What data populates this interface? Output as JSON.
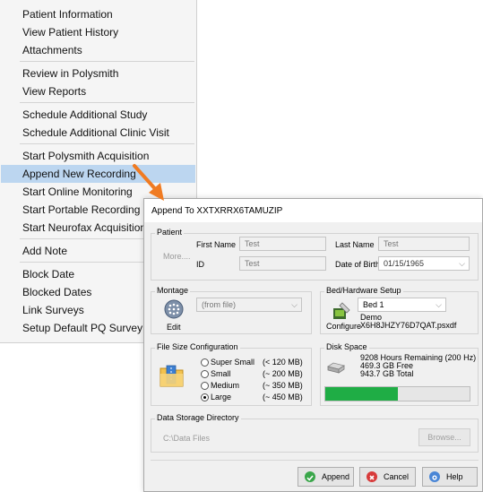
{
  "context_menu": {
    "groups": [
      [
        "Patient Information",
        "View Patient History",
        "Attachments"
      ],
      [
        "Review in Polysmith",
        "View Reports"
      ],
      [
        "Schedule Additional Study",
        "Schedule Additional Clinic Visit"
      ],
      [
        "Start Polysmith Acquisition",
        "Append New Recording",
        "Start Online Monitoring",
        "Start Portable Recording",
        "Start Neurofax Acquisition"
      ],
      [
        "Add Note"
      ],
      [
        "Block Date",
        "Blocked Dates",
        "Link Surveys",
        "Setup Default PQ Survey"
      ]
    ],
    "highlighted_item": "Append New Recording"
  },
  "dialog": {
    "title": "Append To XXTXRRX6TAMUZIP",
    "patient": {
      "group_label": "Patient",
      "first_name_label": "First Name",
      "first_name_value": "Test",
      "last_name_label": "Last Name",
      "last_name_value": "Test",
      "more_link": "More....",
      "id_label": "ID",
      "id_value": "Test",
      "dob_label": "Date of Birth",
      "dob_value": "01/15/1965"
    },
    "montage": {
      "group_label": "Montage",
      "select_value": "(from file)",
      "edit_label": "Edit"
    },
    "bed": {
      "group_label": "Bed/Hardware Setup",
      "select_value": "Bed 1",
      "info_line1": "Demo",
      "info_line2": "X6H8JHZY76D7QAT.psxdf",
      "configure_label": "Configure"
    },
    "file_size": {
      "group_label": "File Size Configuration",
      "options": [
        {
          "label": "Super Small",
          "size": "(< 120 MB)",
          "selected": false
        },
        {
          "label": "Small",
          "size": "(~ 200 MB)",
          "selected": false
        },
        {
          "label": "Medium",
          "size": "(~ 350 MB)",
          "selected": false
        },
        {
          "label": "Large",
          "size": "(~ 450 MB)",
          "selected": true
        }
      ]
    },
    "disk": {
      "group_label": "Disk Space",
      "hours_remaining": "9208 Hours Remaining (200 Hz)",
      "free": "469.3 GB Free",
      "total": "943.7 GB Total",
      "used_fraction": 0.5,
      "bar_color": "#1fad45"
    },
    "storage": {
      "group_label": "Data Storage Directory",
      "path": "C:\\Data Files",
      "browse_label": "Browse..."
    },
    "buttons": {
      "append": "Append",
      "cancel": "Cancel",
      "help": "Help"
    }
  },
  "colors": {
    "highlight": "#bcd6f0",
    "arrow": "#f07b22"
  }
}
